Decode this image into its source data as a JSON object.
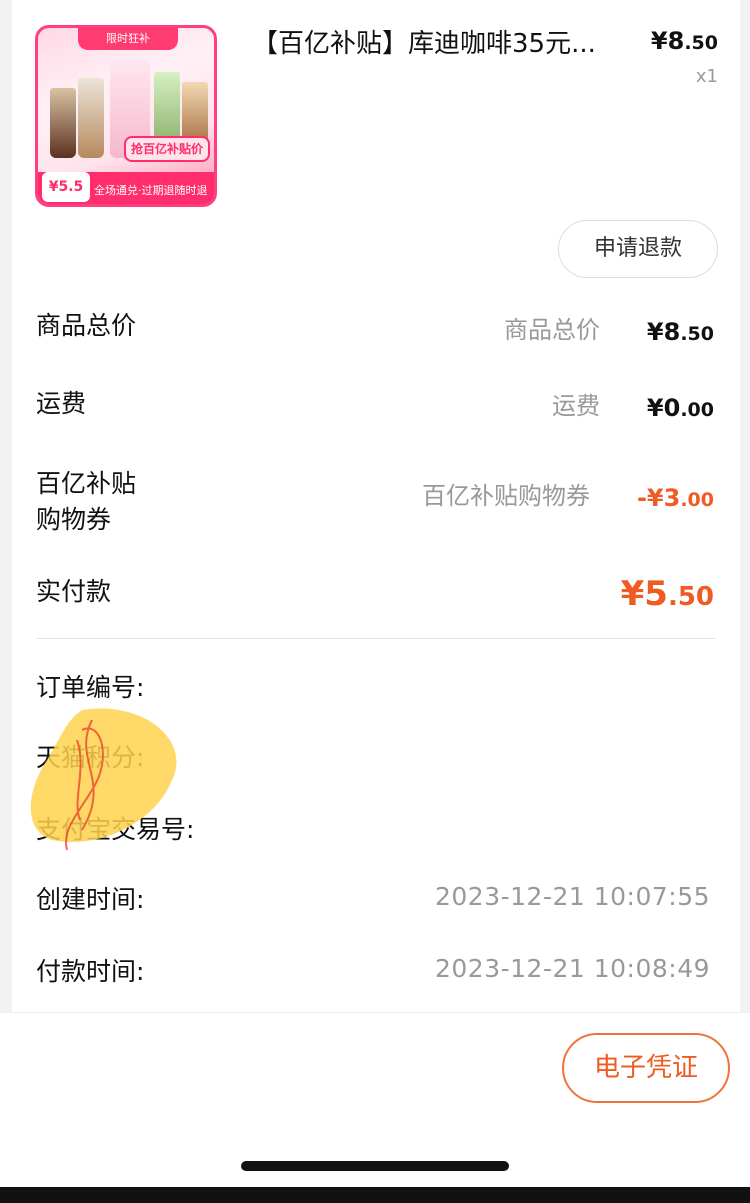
{
  "product": {
    "title": "【百亿补贴】库迪咖啡35元...",
    "price_symbol": "¥",
    "price_int": "8",
    "price_dec": ".50",
    "quantity": "x1",
    "thumb_tag": "限时狂补",
    "thumb_badge": "抢百亿补贴价",
    "thumb_price": "¥5.5",
    "thumb_strip": "全场通兑·过期退随时退"
  },
  "actions": {
    "refund": "申请退款",
    "voucher": "电子凭证"
  },
  "summary": [
    {
      "label": "商品总价",
      "mid": "商品总价",
      "prefix": "¥",
      "int": "8",
      "dec": ".50"
    },
    {
      "label": "运费",
      "mid": "运费",
      "prefix": "¥",
      "int": "0",
      "dec": ".00"
    },
    {
      "label": "百亿补贴\n购物券",
      "mid": "百亿补贴购物券",
      "prefix": "-¥",
      "int": "3",
      "dec": ".00"
    },
    {
      "label": "实付款",
      "prefix": "¥",
      "int": "5",
      "dec": ".50"
    }
  ],
  "order_info": [
    {
      "label": "订单编号:",
      "value": ""
    },
    {
      "label": "天猫积分:",
      "value": ""
    },
    {
      "label": "支付宝交易号:",
      "value": ""
    },
    {
      "label": "创建时间:",
      "value": "2023-12-21 10:07:55"
    },
    {
      "label": "付款时间:",
      "value": "2023-12-21 10:08:49"
    }
  ],
  "colors": {
    "accent": "#f05a23",
    "muted": "#999999",
    "brand_pink": "#ff2d6c"
  }
}
